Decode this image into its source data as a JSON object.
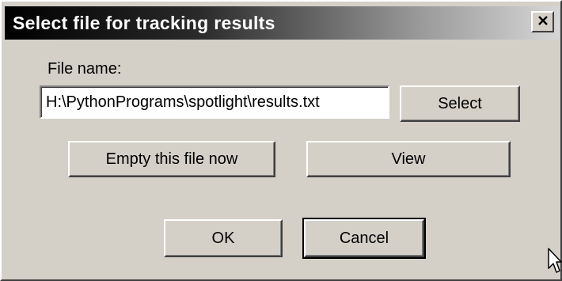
{
  "window": {
    "title": "Select file for tracking results",
    "close_label": "×"
  },
  "form": {
    "file_label": "File name:",
    "file_value": "H:\\PythonPrograms\\spotlight\\results.txt"
  },
  "buttons": {
    "select": "Select",
    "empty": "Empty this file now",
    "view": "View",
    "ok": "OK",
    "cancel": "Cancel"
  },
  "icons": {
    "close": "close-icon",
    "cursor": "mouse-pointer-icon"
  }
}
